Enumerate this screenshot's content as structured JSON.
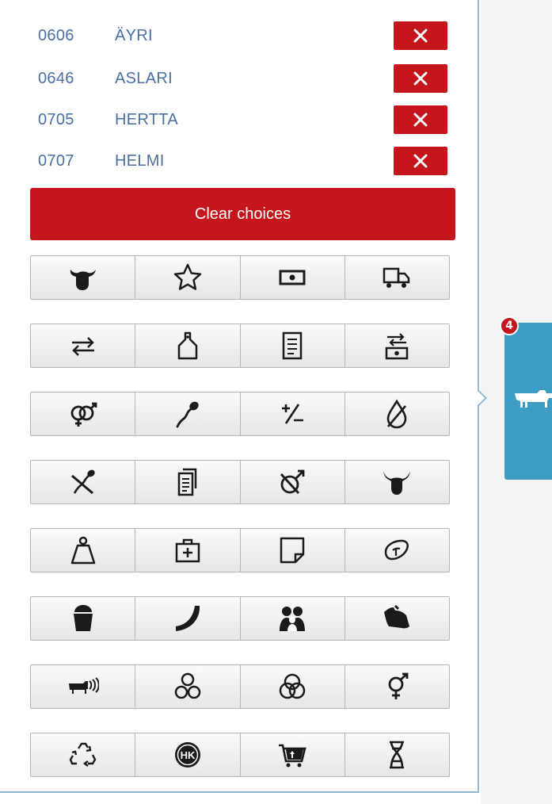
{
  "selections": [
    {
      "number": "0606",
      "name": "ÄYRI"
    },
    {
      "number": "0646",
      "name": "ASLARI"
    },
    {
      "number": "0705",
      "name": "HERTTA"
    },
    {
      "number": "0707",
      "name": "HELMI"
    }
  ],
  "clear_button_label": "Clear choices",
  "icon_rows": [
    [
      "cow-head-icon",
      "star-icon",
      "money-icon",
      "truck-icon"
    ],
    [
      "swap-arrows-icon",
      "ear-tag-icon",
      "document-icon",
      "money-exchange-icon"
    ],
    [
      "gender-symbols-icon",
      "sperm-icon",
      "plus-minus-icon",
      "no-drop-icon"
    ],
    [
      "no-insemination-icon",
      "documents-icon",
      "no-male-icon",
      "bull-head-icon"
    ],
    [
      "weight-icon",
      "first-aid-icon",
      "note-icon",
      "meat-cut-icon"
    ],
    [
      "milk-bucket-icon",
      "horn-icon",
      "family-icon",
      "calving-icon"
    ],
    [
      "cow-signal-icon",
      "group-circles-icon",
      "venn-circles-icon",
      "hermaphrodite-icon"
    ],
    [
      "recycle-icon",
      "hk-logo-icon",
      "cart-icon",
      "dna-icon"
    ]
  ],
  "hk_logo_text": "HK",
  "side_tile": {
    "badge_count": "4",
    "icon": "cow-icon"
  },
  "colors": {
    "accent_red": "#c4161c",
    "link_blue": "#4a6fa5",
    "tile_blue": "#3c9cc4"
  }
}
